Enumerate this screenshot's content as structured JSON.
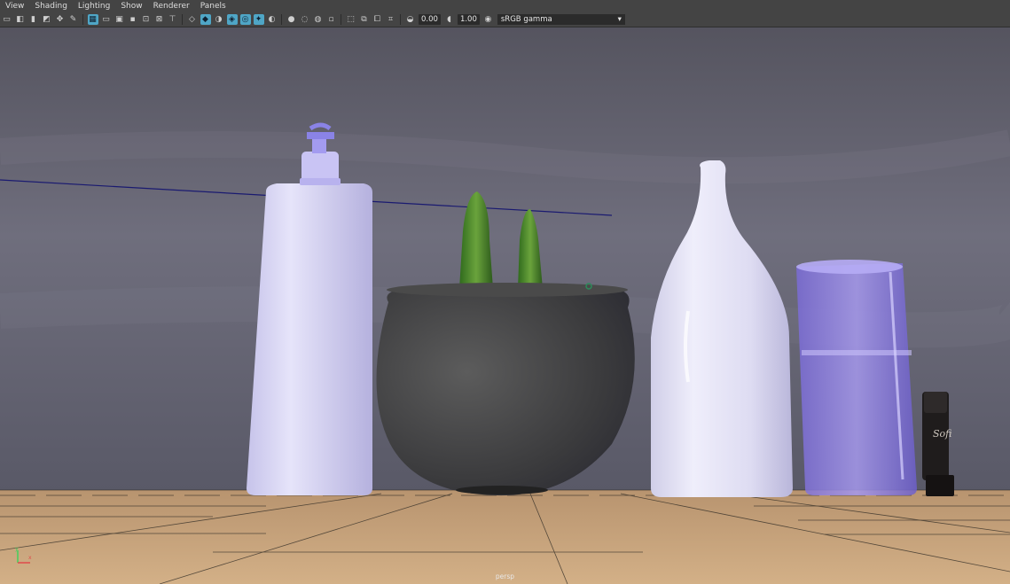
{
  "menu": [
    "View",
    "Shading",
    "Lighting",
    "Show",
    "Renderer",
    "Panels"
  ],
  "toolbar": {
    "camera_icons": [
      "camera-icon",
      "camera-attr-icon",
      "bookmark-icon",
      "image-plane-icon",
      "2d-pan-icon",
      "grease-pencil-icon"
    ],
    "grid_icons": [
      "grid-icon",
      "film-gate-icon",
      "resolution-gate-icon",
      "gate-mask-icon",
      "field-chart-icon",
      "safe-action-icon",
      "safe-title-icon"
    ],
    "shading_icons": [
      "wireframe-icon",
      "smooth-shade-icon",
      "use-default-material-icon",
      "wireframe-on-shaded-icon",
      "xray-icon",
      "use-all-lights-icon",
      "shadows-icon"
    ],
    "render_icons": [
      "ambient-occlusion-icon",
      "motion-blur-icon",
      "anti-aliasing-icon",
      "depth-of-field-icon"
    ],
    "isolate_icons": [
      "isolate-select-icon",
      "xray-joints-icon",
      "xray-active-icon",
      "camera-bookmarks-icon"
    ],
    "exposure_value": "0.00",
    "gamma_value": "1.00",
    "color_space": "sRGB gamma"
  },
  "viewport": {
    "camera_label": "persp",
    "bottle_label_text": "Sofi",
    "colors": {
      "wall": "#6b6a7a",
      "floor": "#c8a47e",
      "bottle": "#d6d4f0",
      "glass": "#8f7fe0",
      "pot": "#4b4b4b",
      "cactus": "#4c8a2c",
      "pump": "#8a83e6"
    }
  },
  "axis": {
    "x": "x",
    "y": "y"
  }
}
